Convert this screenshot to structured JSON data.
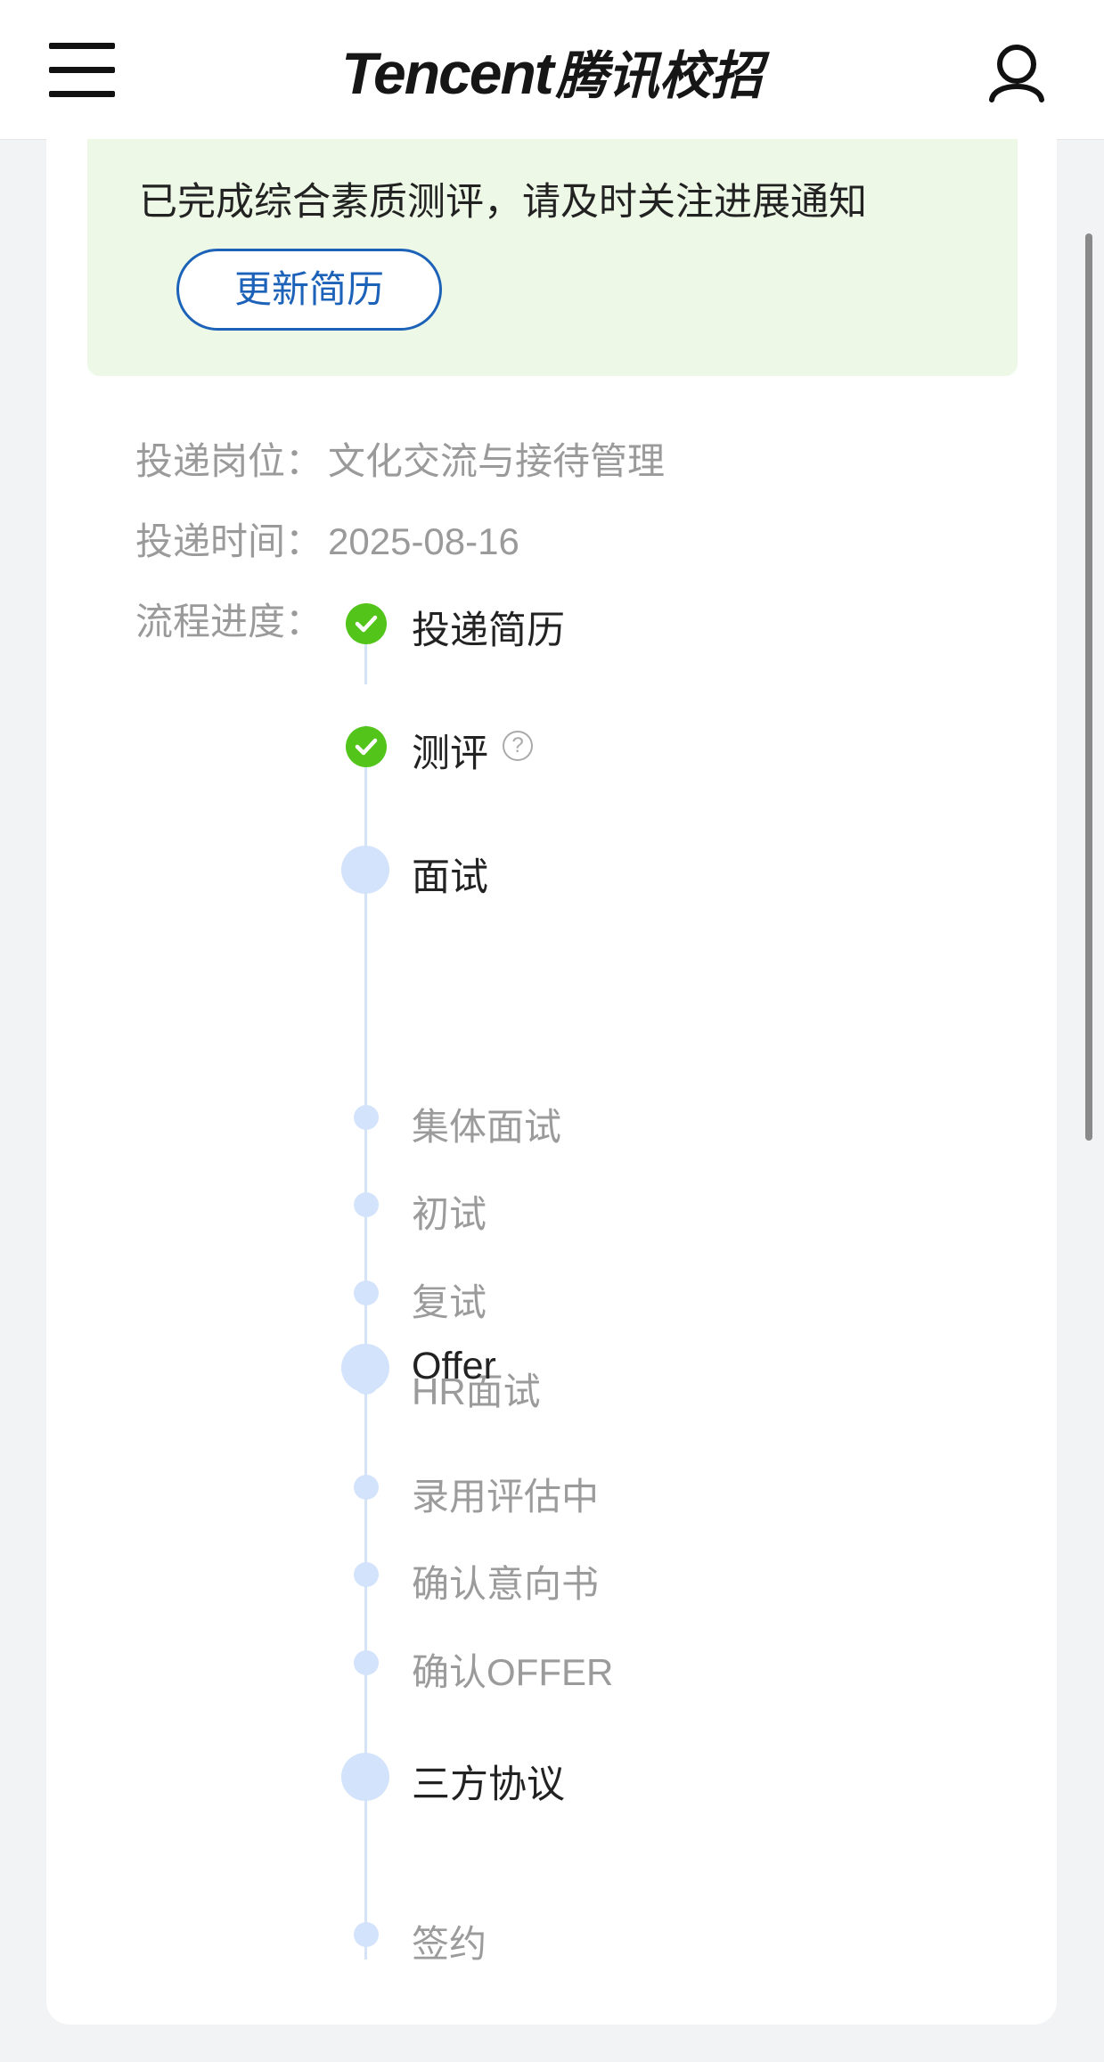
{
  "header": {
    "brand_en": "Tencent",
    "brand_cn": "腾讯校招",
    "menu_icon": "hamburger-menu-icon",
    "user_icon": "user-profile-icon"
  },
  "notice": {
    "text": "已完成综合素质测评，请及时关注进展通知",
    "button_label": "更新简历",
    "background_color": "#edf9e6",
    "button_color": "#1c62b9"
  },
  "application": {
    "position_label": "投递岗位：",
    "position_value": "文化交流与接待管理",
    "time_label": "投递时间：",
    "time_value": "2025-08-16",
    "progress_label": "流程进度："
  },
  "progress": {
    "done_color": "#52c41a",
    "pending_color": "#d3e3fb",
    "steps": [
      {
        "label": "投递简历",
        "status": "done"
      },
      {
        "label": "测评",
        "status": "done",
        "help_icon": "help-circle-icon",
        "help_glyph": "?"
      },
      {
        "label": "面试",
        "status": "pending",
        "substeps": [
          "集体面试",
          "初试",
          "复试",
          "HR面试"
        ]
      },
      {
        "label": "Offer",
        "status": "pending",
        "substeps": [
          "录用评估中",
          "确认意向书",
          "确认OFFER"
        ]
      },
      {
        "label": "三方协议",
        "status": "pending",
        "substeps": [
          "签约"
        ]
      }
    ]
  }
}
